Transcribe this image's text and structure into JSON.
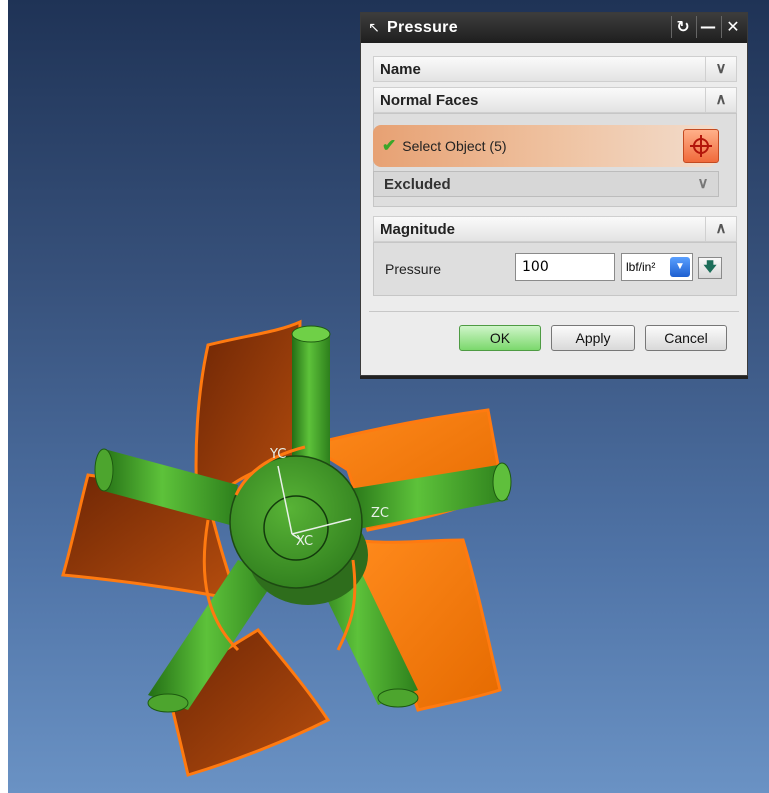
{
  "dialog": {
    "title": "Pressure",
    "title_icon": "arrow-icon",
    "controls": [
      "reset-icon",
      "minimize-icon",
      "close-icon"
    ],
    "groups": {
      "name": {
        "label": "Name",
        "state": "collapsed"
      },
      "normal_faces": {
        "label": "Normal Faces",
        "state": "expanded",
        "select_object": "Select Object (5)",
        "excluded_label": "Excluded"
      },
      "magnitude": {
        "label": "Magnitude",
        "state": "expanded",
        "pressure_label": "Pressure",
        "pressure_value": "100",
        "unit": "lbf/in²"
      }
    },
    "buttons": {
      "ok": "OK",
      "apply": "Apply",
      "cancel": "Cancel"
    }
  },
  "viewport": {
    "axis_labels": {
      "yc": "YC",
      "zc": "ZC",
      "xc": "XC"
    },
    "colors": {
      "background_top": "#1f3356",
      "background_bottom": "#6a92c4",
      "arm_green": "#49a52d",
      "blade_orange": "#f07a0c",
      "blade_dark": "#a3410a"
    }
  }
}
